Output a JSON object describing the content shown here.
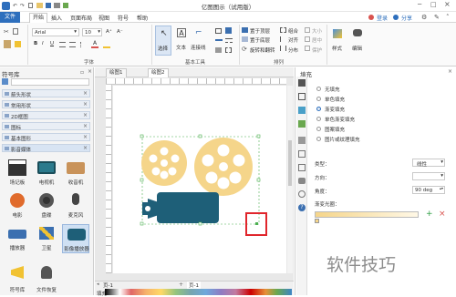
{
  "app": {
    "title": "亿图图示（试用版）"
  },
  "menu": {
    "items": [
      "文件",
      "开始",
      "插入",
      "页面布局",
      "视图",
      "符号",
      "帮助"
    ]
  },
  "topright": {
    "login": "登录",
    "share": "分享"
  },
  "ribbon": {
    "font_name": "Arial",
    "font_size": "10",
    "bold": "B",
    "italic": "I",
    "underline": "U",
    "select_label": "选择",
    "text_label": "文本",
    "connector_label": "连接线",
    "bring_front": "置于顶层",
    "send_back": "置于底层",
    "rotate_flip": "旋转和翻转",
    "group": "组合",
    "align": "对齐",
    "distribute": "分布",
    "size": "大小",
    "center": "居中",
    "protect": "保护",
    "style_label": "样式",
    "edit_label": "编辑",
    "group_font": "字体",
    "group_tools": "基本工具",
    "group_arrange": "排列"
  },
  "library": {
    "title": "符号库",
    "items": [
      "箭头形状",
      "常用形状",
      "2D框图",
      "图标",
      "基本图形",
      "影音媒体"
    ],
    "shapes": [
      [
        "场记板",
        "电视机",
        "收音机"
      ],
      [
        "电影",
        "盘碟",
        "麦克风"
      ],
      [
        "播放器",
        "卫星",
        "影像播放器"
      ],
      [
        "符号库",
        "文件恢复",
        ""
      ]
    ]
  },
  "canvas": {
    "tabs": [
      "绘图1",
      "绘图2"
    ],
    "page_label": "页-1",
    "page_tab": "页-1"
  },
  "fill": {
    "title": "填充",
    "options": [
      "无填充",
      "单色填充",
      "渐变填充",
      "单色渐变填充",
      "图案填充",
      "图片或纹理填充"
    ],
    "selected": "渐变填充",
    "type_label": "类型：",
    "type_value": "线性",
    "direction_label": "方向：",
    "angle_label": "角度：",
    "angle_value": "90 deg",
    "gradient_label": "渐变光圈："
  },
  "status": {
    "fill_label": "填充"
  },
  "colors": {
    "accent": "#2e6fbd",
    "reel": "#f5d58a",
    "camera": "#1e5f78",
    "highlight": "#e0262c",
    "guide": "#4caf50"
  },
  "watermark": "软件技巧"
}
